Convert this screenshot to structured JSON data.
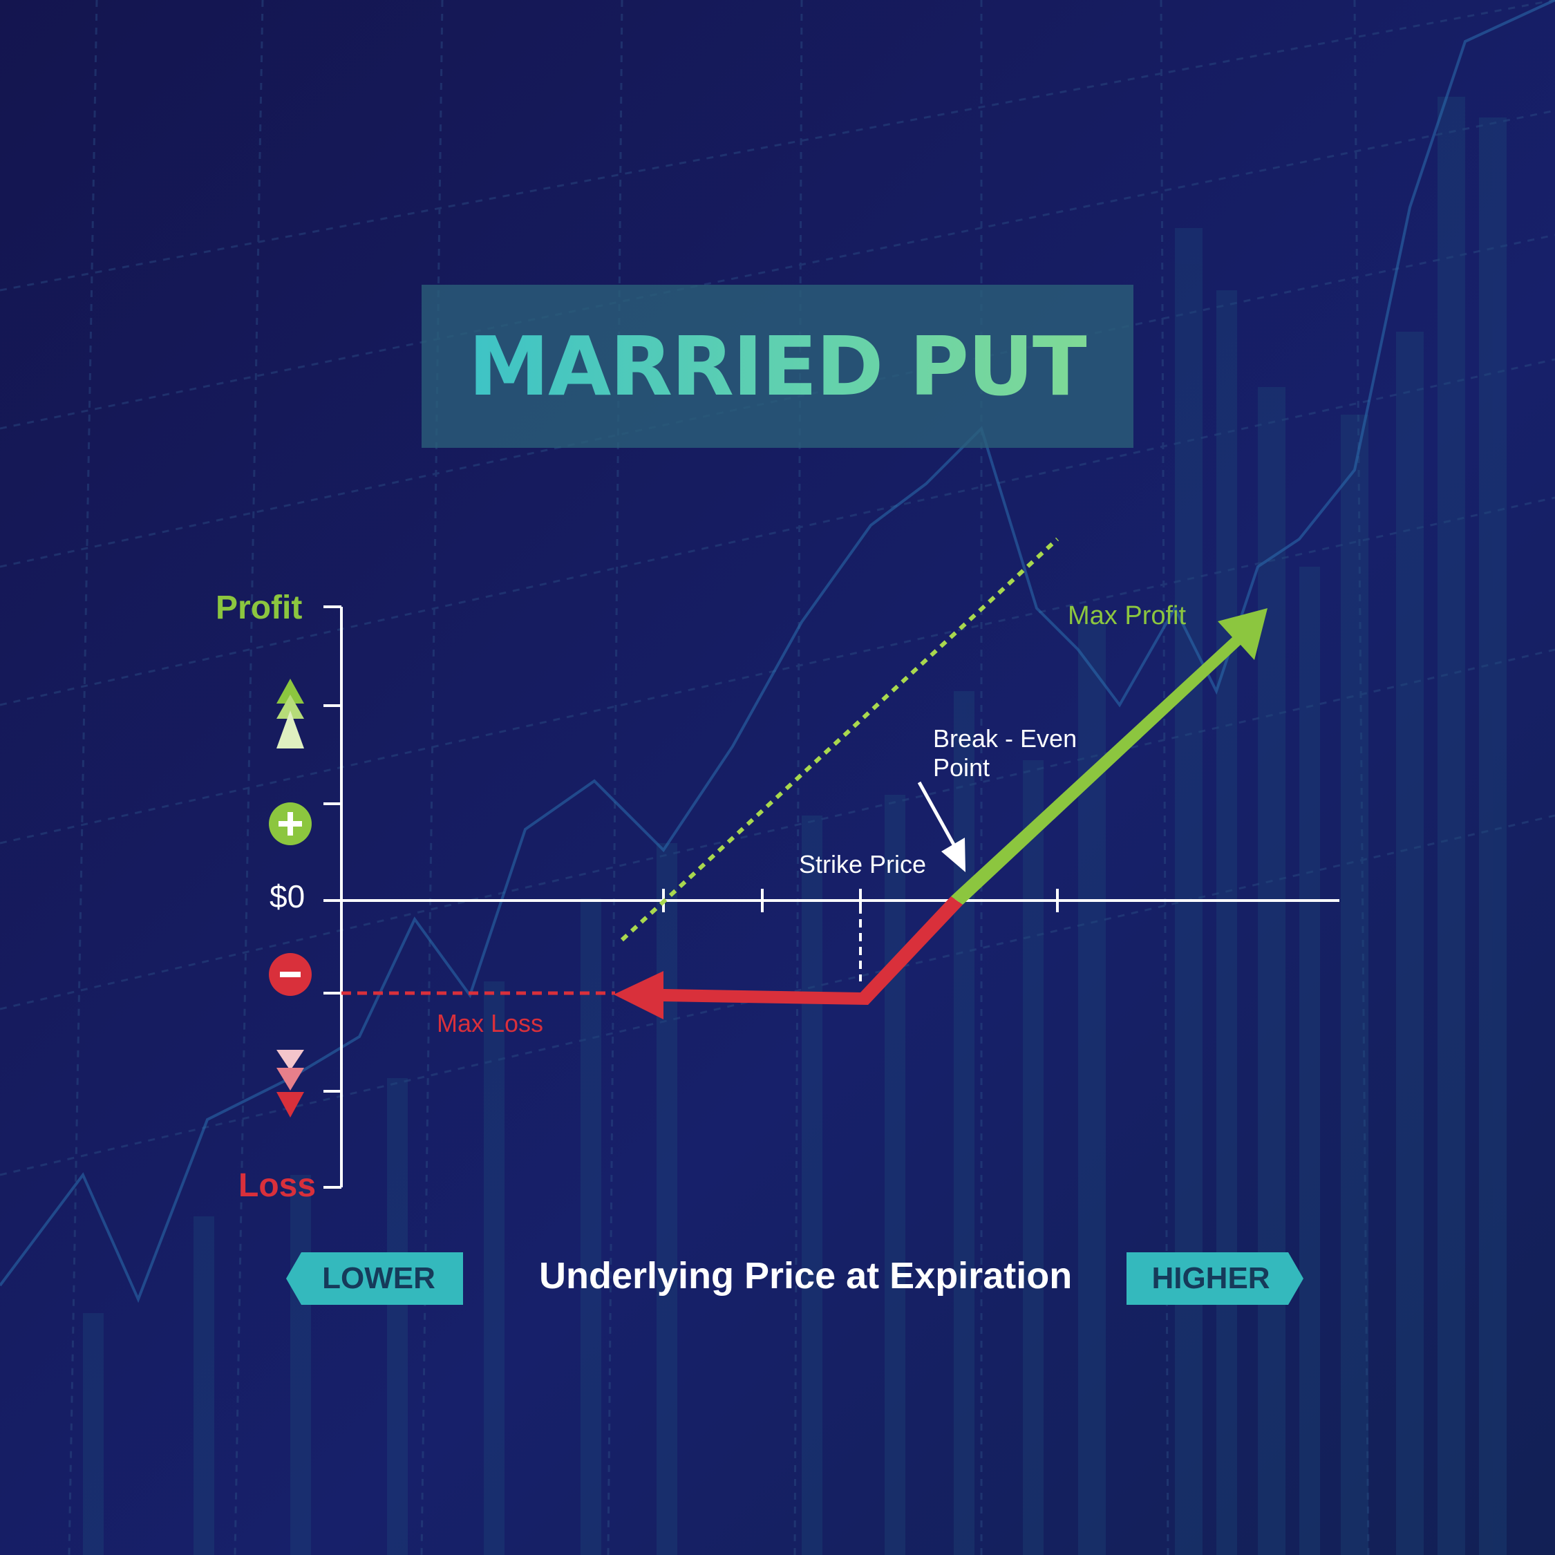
{
  "title": "MARRIED PUT",
  "y_axis": {
    "top_label": "Profit",
    "bottom_label": "Loss",
    "zero_label": "$0"
  },
  "annotations": {
    "max_profit": "Max Profit",
    "break_even_line1": "Break - Even",
    "break_even_line2": "Point",
    "strike_price": "Strike Price",
    "max_loss": "Max Loss"
  },
  "x_axis": {
    "title": "Underlying Price at Expiration",
    "lower_label": "LOWER",
    "higher_label": "HIGHER"
  },
  "icons": [
    "plus-icon",
    "minus-icon",
    "up-triangles-icon",
    "down-triangles-icon"
  ],
  "colors": {
    "background": "#15175a",
    "profit_green": "#8cc63f",
    "loss_red": "#d9303b",
    "accent_teal": "#34b9bd",
    "title_box": "#2c607a"
  }
}
